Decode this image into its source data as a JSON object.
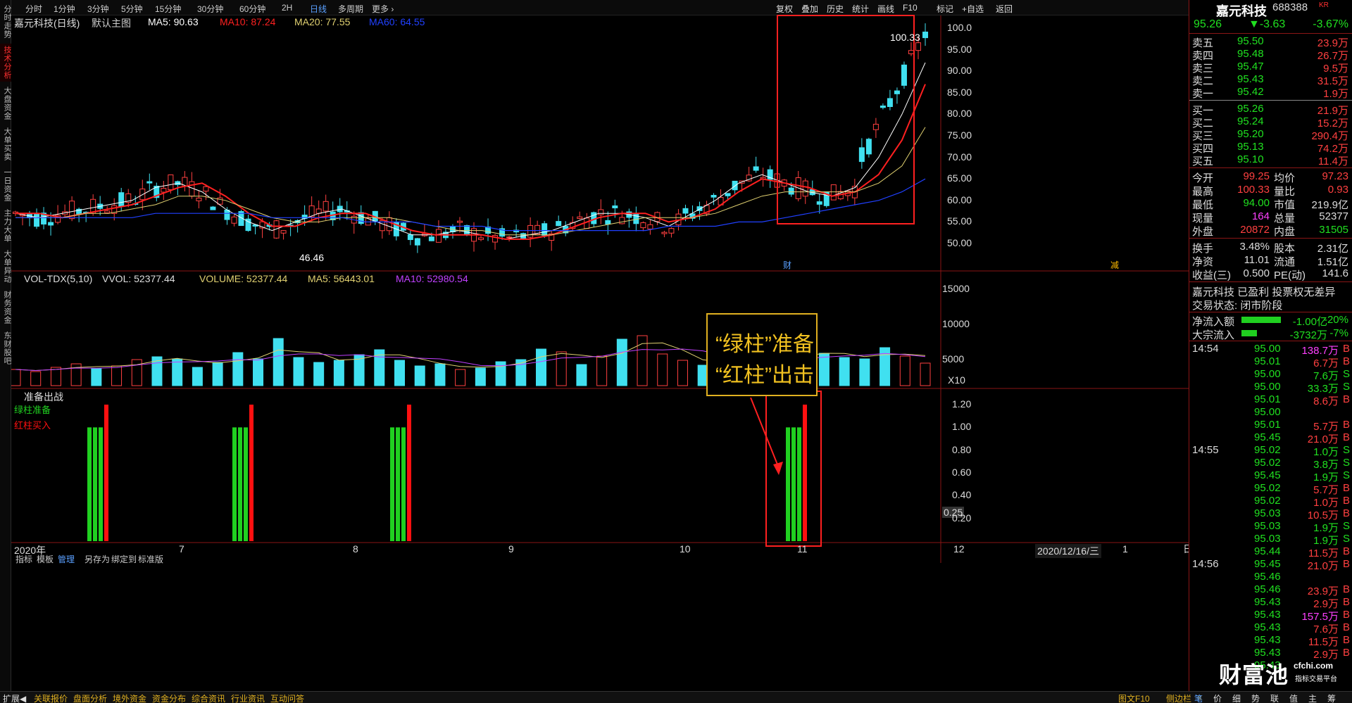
{
  "left_tabs": [
    {
      "label": "分时走势",
      "active": false
    },
    {
      "label": "技术分析",
      "active": true
    },
    {
      "label": "大盘资金",
      "active": false
    },
    {
      "label": "大单买卖",
      "active": false
    },
    {
      "label": "一日资金",
      "active": false
    },
    {
      "label": "主力大单",
      "active": false
    },
    {
      "label": "大单异动",
      "active": false
    },
    {
      "label": "财务资金",
      "active": false
    },
    {
      "label": "东财股吧",
      "active": false
    }
  ],
  "periods": [
    "分时",
    "1分钟",
    "3分钟",
    "5分钟",
    "15分钟",
    "30分钟",
    "60分钟",
    "2H",
    "日线",
    "多周期",
    "更多 ›"
  ],
  "active_period": "日线",
  "toolbar_right": [
    "复权",
    "叠加",
    "历史",
    "统计",
    "画线",
    "F10",
    "标记",
    "+自选",
    "返回"
  ],
  "main_legend": {
    "title": "嘉元科技(日线)",
    "template": "默认主图",
    "ma5": "MA5: 90.63",
    "ma10": "MA10: 87.24",
    "ma20": "MA20: 77.55",
    "ma60": "MA60: 64.55"
  },
  "colors": {
    "ma5": "#ffffff",
    "ma10": "#ff2020",
    "ma20": "#e0d070",
    "ma60": "#2040ff",
    "up": "#ff4040",
    "down": "#40e0f0",
    "green": "#20d020",
    "red": "#ff1010",
    "vol_ma5": "#e0d070",
    "vol_ma10": "#c040ff"
  },
  "price_axis": [
    "100.0",
    "95.00",
    "90.00",
    "85.00",
    "80.00",
    "75.00",
    "70.00",
    "65.00",
    "60.00",
    "55.00",
    "50.00"
  ],
  "high_label": "100.33",
  "low_label": "46.46",
  "markers": {
    "cai": "财",
    "jian": "减"
  },
  "vol_legend": {
    "title": "VOL-TDX(5,10)",
    "vvol": "VVOL: 52377.44",
    "volume": "VOLUME: 52377.44",
    "ma5": "MA5: 56443.01",
    "ma10": "MA10: 52980.54"
  },
  "vol_axis": [
    "15000",
    "10000",
    "5000"
  ],
  "vol_unit": "X10",
  "indicator": {
    "title": "准备出战",
    "green_label": "绿柱准备",
    "red_label": "红柱买入",
    "axis": [
      "1.20",
      "1.00",
      "0.80",
      "0.60",
      "0.40",
      "0.25",
      "0.20"
    ]
  },
  "annotation": {
    "line1": "“绿柱”准备",
    "line2": "“红柱”出击"
  },
  "x_axis": {
    "labels": [
      "2020年",
      "7",
      "8",
      "9",
      "10",
      "11",
      "12"
    ],
    "date": "2020/12/16/三",
    "right": "1",
    "period_btn": "日线"
  },
  "bottom_tabs": [
    "指标",
    "模板",
    "管理",
    "另存为",
    "绑定到",
    "标准版"
  ],
  "status_bar": [
    "扩展◀",
    "关联报价",
    "盘面分析",
    "境外资金",
    "资金分布",
    "综合资讯",
    "行业资讯",
    "互动问答"
  ],
  "status_right": [
    "图文F10",
    "侧边栏",
    "«"
  ],
  "stock": {
    "name": "嘉元科技",
    "code": "688388",
    "tag": "KR",
    "price": "95.26",
    "change": "▼-3.63",
    "pct": "-3.67%"
  },
  "asks": [
    {
      "label": "卖五",
      "price": "95.50",
      "vol": "23.9万"
    },
    {
      "label": "卖四",
      "price": "95.48",
      "vol": "26.7万"
    },
    {
      "label": "卖三",
      "price": "95.47",
      "vol": "9.5万"
    },
    {
      "label": "卖二",
      "price": "95.43",
      "vol": "31.5万"
    },
    {
      "label": "卖一",
      "price": "95.42",
      "vol": "1.9万"
    }
  ],
  "bids": [
    {
      "label": "买一",
      "price": "95.26",
      "vol": "21.9万"
    },
    {
      "label": "买二",
      "price": "95.24",
      "vol": "15.2万"
    },
    {
      "label": "买三",
      "price": "95.20",
      "vol": "290.4万"
    },
    {
      "label": "买四",
      "price": "95.13",
      "vol": "74.2万"
    },
    {
      "label": "买五",
      "price": "95.10",
      "vol": "11.4万"
    }
  ],
  "stats": [
    [
      "今开",
      "99.25",
      "均价",
      "97.23"
    ],
    [
      "最高",
      "100.33",
      "量比",
      "0.93"
    ],
    [
      "最低",
      "94.00",
      "市值",
      "219.9亿"
    ],
    [
      "现量",
      "164",
      "总量",
      "52377"
    ],
    [
      "外盘",
      "20872",
      "内盘",
      "31505"
    ]
  ],
  "stats2": [
    [
      "换手",
      "3.48%",
      "股本",
      "2.31亿"
    ],
    [
      "净资",
      "11.01",
      "流通",
      "1.51亿"
    ],
    [
      "收益(三)",
      "0.500",
      "PE(动)",
      "141.6"
    ]
  ],
  "info1": "嘉元科技 已盈利 投票权无差异",
  "info2": "交易状态: 闭市阶段",
  "flows": [
    {
      "label": "净流入额",
      "value": "-1.00亿",
      "pct": "-20%"
    },
    {
      "label": "大宗流入",
      "value": "-3732万",
      "pct": "-7%"
    }
  ],
  "ticks": [
    {
      "time": "14:54",
      "price": "95.00",
      "vol": "138.7万",
      "side": "B"
    },
    {
      "time": "",
      "price": "95.01",
      "vol": "6.7万",
      "side": "B"
    },
    {
      "time": "",
      "price": "95.00",
      "vol": "7.6万",
      "side": "S"
    },
    {
      "time": "",
      "price": "95.00",
      "vol": "33.3万",
      "side": "S"
    },
    {
      "time": "",
      "price": "95.01",
      "vol": "8.6万",
      "side": "B"
    },
    {
      "time": "",
      "price": "95.00",
      "vol": "",
      "side": ""
    },
    {
      "time": "",
      "price": "95.01",
      "vol": "5.7万",
      "side": "B"
    },
    {
      "time": "",
      "price": "95.45",
      "vol": "21.0万",
      "side": "B"
    },
    {
      "time": "14:55",
      "price": "95.02",
      "vol": "1.0万",
      "side": "S"
    },
    {
      "time": "",
      "price": "95.02",
      "vol": "3.8万",
      "side": "S"
    },
    {
      "time": "",
      "price": "95.45",
      "vol": "1.9万",
      "side": "S"
    },
    {
      "time": "",
      "price": "95.02",
      "vol": "5.7万",
      "side": "B"
    },
    {
      "time": "",
      "price": "95.02",
      "vol": "1.0万",
      "side": "B"
    },
    {
      "time": "",
      "price": "95.03",
      "vol": "10.5万",
      "side": "B"
    },
    {
      "time": "",
      "price": "95.03",
      "vol": "1.9万",
      "side": "S"
    },
    {
      "time": "",
      "price": "95.03",
      "vol": "1.9万",
      "side": "S"
    },
    {
      "time": "",
      "price": "95.44",
      "vol": "11.5万",
      "side": "B"
    },
    {
      "time": "14:56",
      "price": "95.45",
      "vol": "21.0万",
      "side": "B"
    },
    {
      "time": "",
      "price": "95.46",
      "vol": "",
      "side": ""
    },
    {
      "time": "",
      "price": "95.46",
      "vol": "23.9万",
      "side": "B"
    },
    {
      "time": "",
      "price": "95.43",
      "vol": "2.9万",
      "side": "B"
    },
    {
      "time": "",
      "price": "95.43",
      "vol": "157.5万",
      "side": "B"
    },
    {
      "time": "",
      "price": "95.43",
      "vol": "7.6万",
      "side": "B"
    },
    {
      "time": "",
      "price": "95.43",
      "vol": "11.5万",
      "side": "B"
    },
    {
      "time": "",
      "price": "95.43",
      "vol": "2.9万",
      "side": "B"
    },
    {
      "time": "",
      "price": "95.43",
      "vol": "",
      "side": ""
    }
  ],
  "bottom_right_tabs": [
    "笔",
    "价",
    "细",
    "势",
    "联",
    "值",
    "主",
    "筹"
  ],
  "watermark": {
    "text": "财富池",
    "domain": "cfchi.com",
    "sub": "指标交易平台"
  },
  "chart_data": [
    {
      "type": "line",
      "title": "嘉元科技(日线)",
      "x": [
        "2020年",
        "7",
        "8",
        "9",
        "10",
        "11",
        "12"
      ],
      "ylim": [
        46,
        101
      ],
      "series": [
        {
          "name": "MA5",
          "values": [
            57,
            56,
            57,
            58,
            59,
            60,
            63,
            64,
            62,
            58,
            55,
            53,
            55,
            57,
            58,
            56,
            54,
            52,
            52,
            53,
            52,
            51,
            52,
            53,
            55,
            57,
            57,
            56,
            54,
            57,
            60,
            64,
            66,
            64,
            62,
            61,
            63,
            70,
            80,
            92
          ]
        },
        {
          "name": "MA10",
          "values": [
            57,
            57,
            56,
            57,
            58,
            59,
            61,
            63,
            64,
            61,
            57,
            54,
            54,
            56,
            57,
            57,
            55,
            53,
            52,
            52,
            52,
            51,
            51,
            52,
            54,
            56,
            57,
            57,
            55,
            56,
            58,
            62,
            65,
            64,
            63,
            61,
            62,
            66,
            74,
            87
          ]
        },
        {
          "name": "MA20",
          "values": [
            56,
            56,
            56,
            57,
            57,
            58,
            59,
            61,
            61,
            60,
            58,
            56,
            55,
            55,
            56,
            56,
            56,
            55,
            54,
            53,
            53,
            52,
            52,
            52,
            53,
            54,
            55,
            56,
            56,
            56,
            57,
            59,
            61,
            62,
            62,
            62,
            62,
            64,
            68,
            77
          ]
        },
        {
          "name": "MA60",
          "values": [
            56,
            56,
            56,
            56,
            56,
            56,
            57,
            57,
            57,
            57,
            57,
            56,
            56,
            56,
            56,
            55,
            55,
            55,
            54,
            54,
            54,
            53,
            53,
            53,
            53,
            53,
            53,
            53,
            54,
            54,
            54,
            55,
            55,
            56,
            57,
            58,
            59,
            60,
            62,
            65
          ]
        }
      ],
      "annotations": [
        "100.33",
        "46.46"
      ]
    },
    {
      "type": "bar",
      "title": "VOL-TDX(5,10)",
      "ylim": [
        0,
        15000
      ],
      "series": [
        {
          "name": "VOLUME",
          "values": [
            2300,
            2000,
            2600,
            3100,
            2400,
            2800,
            3700,
            4100,
            3800,
            2600,
            3300,
            4700,
            3800,
            6700,
            4000,
            3300,
            3600,
            4400,
            5100,
            3600,
            2800,
            3100,
            2300,
            2500,
            3400,
            3700,
            5200,
            4800,
            3000,
            4200,
            6600,
            7100,
            4500,
            3600,
            2900,
            3600,
            3100,
            3300,
            4100,
            5100,
            4600,
            4000,
            3800,
            5400,
            4200,
            3200
          ]
        }
      ]
    },
    {
      "type": "bar",
      "title": "准备出战",
      "ylim": [
        0,
        1.2
      ],
      "series": [
        {
          "name": "绿柱准备",
          "values": [
            1,
            1,
            1,
            1,
            1,
            1,
            1,
            1,
            1,
            1,
            1,
            1
          ]
        },
        {
          "name": "红柱买入",
          "values": [
            1.2,
            1.2,
            1.2,
            1.2
          ]
        }
      ]
    }
  ]
}
